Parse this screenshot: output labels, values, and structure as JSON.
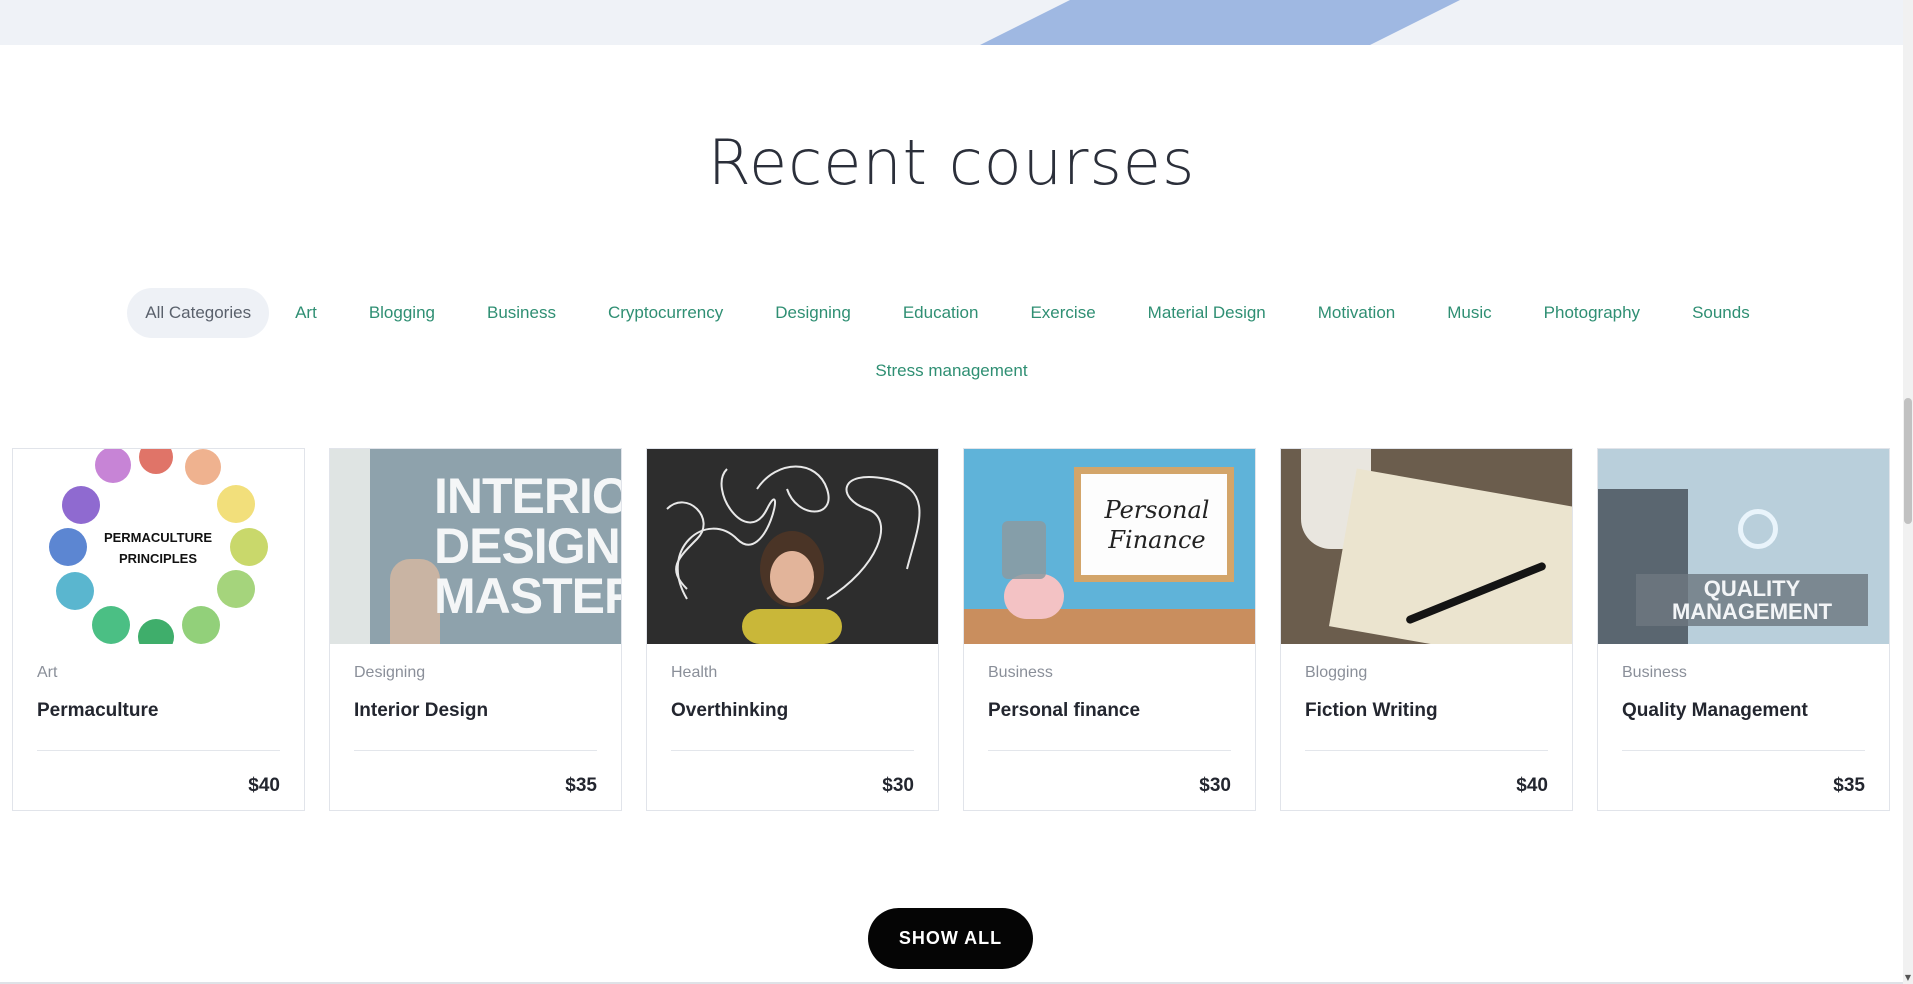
{
  "section": {
    "title": "Recent courses"
  },
  "filters": {
    "row1": [
      "All Categories",
      "Art",
      "Blogging",
      "Business",
      "Cryptocurrency",
      "Designing",
      "Education",
      "Exercise",
      "Material Design",
      "Motivation",
      "Music",
      "Photography",
      "Sounds"
    ],
    "row2": [
      "Stress management"
    ],
    "active": "All Categories",
    "active_bg": "#eef1f6",
    "link_color": "#2f8f73"
  },
  "courses": [
    {
      "category": "Art",
      "title": "Permaculture",
      "price": "$40",
      "image_text": [
        "PERMACULTURE",
        "PRINCIPLES"
      ]
    },
    {
      "category": "Designing",
      "title": "Interior Design",
      "price": "$35",
      "image_text": [
        "INTERIO",
        "DESIGN",
        "MASTER"
      ]
    },
    {
      "category": "Health",
      "title": "Overthinking",
      "price": "$30"
    },
    {
      "category": "Business",
      "title": "Personal finance",
      "price": "$30",
      "image_text": [
        "Personal",
        "Finance"
      ]
    },
    {
      "category": "Blogging",
      "title": "Fiction Writing",
      "price": "$40"
    },
    {
      "category": "Business",
      "title": "Quality Management",
      "price": "$35",
      "image_text": [
        "QUALITY",
        "MANAGEMENT"
      ]
    }
  ],
  "actions": {
    "show_all_label": "SHOW ALL"
  },
  "colors": {
    "button_bg": "#050505",
    "top_band": "#eff2f7",
    "top_stripe": "#9fb8e2"
  }
}
